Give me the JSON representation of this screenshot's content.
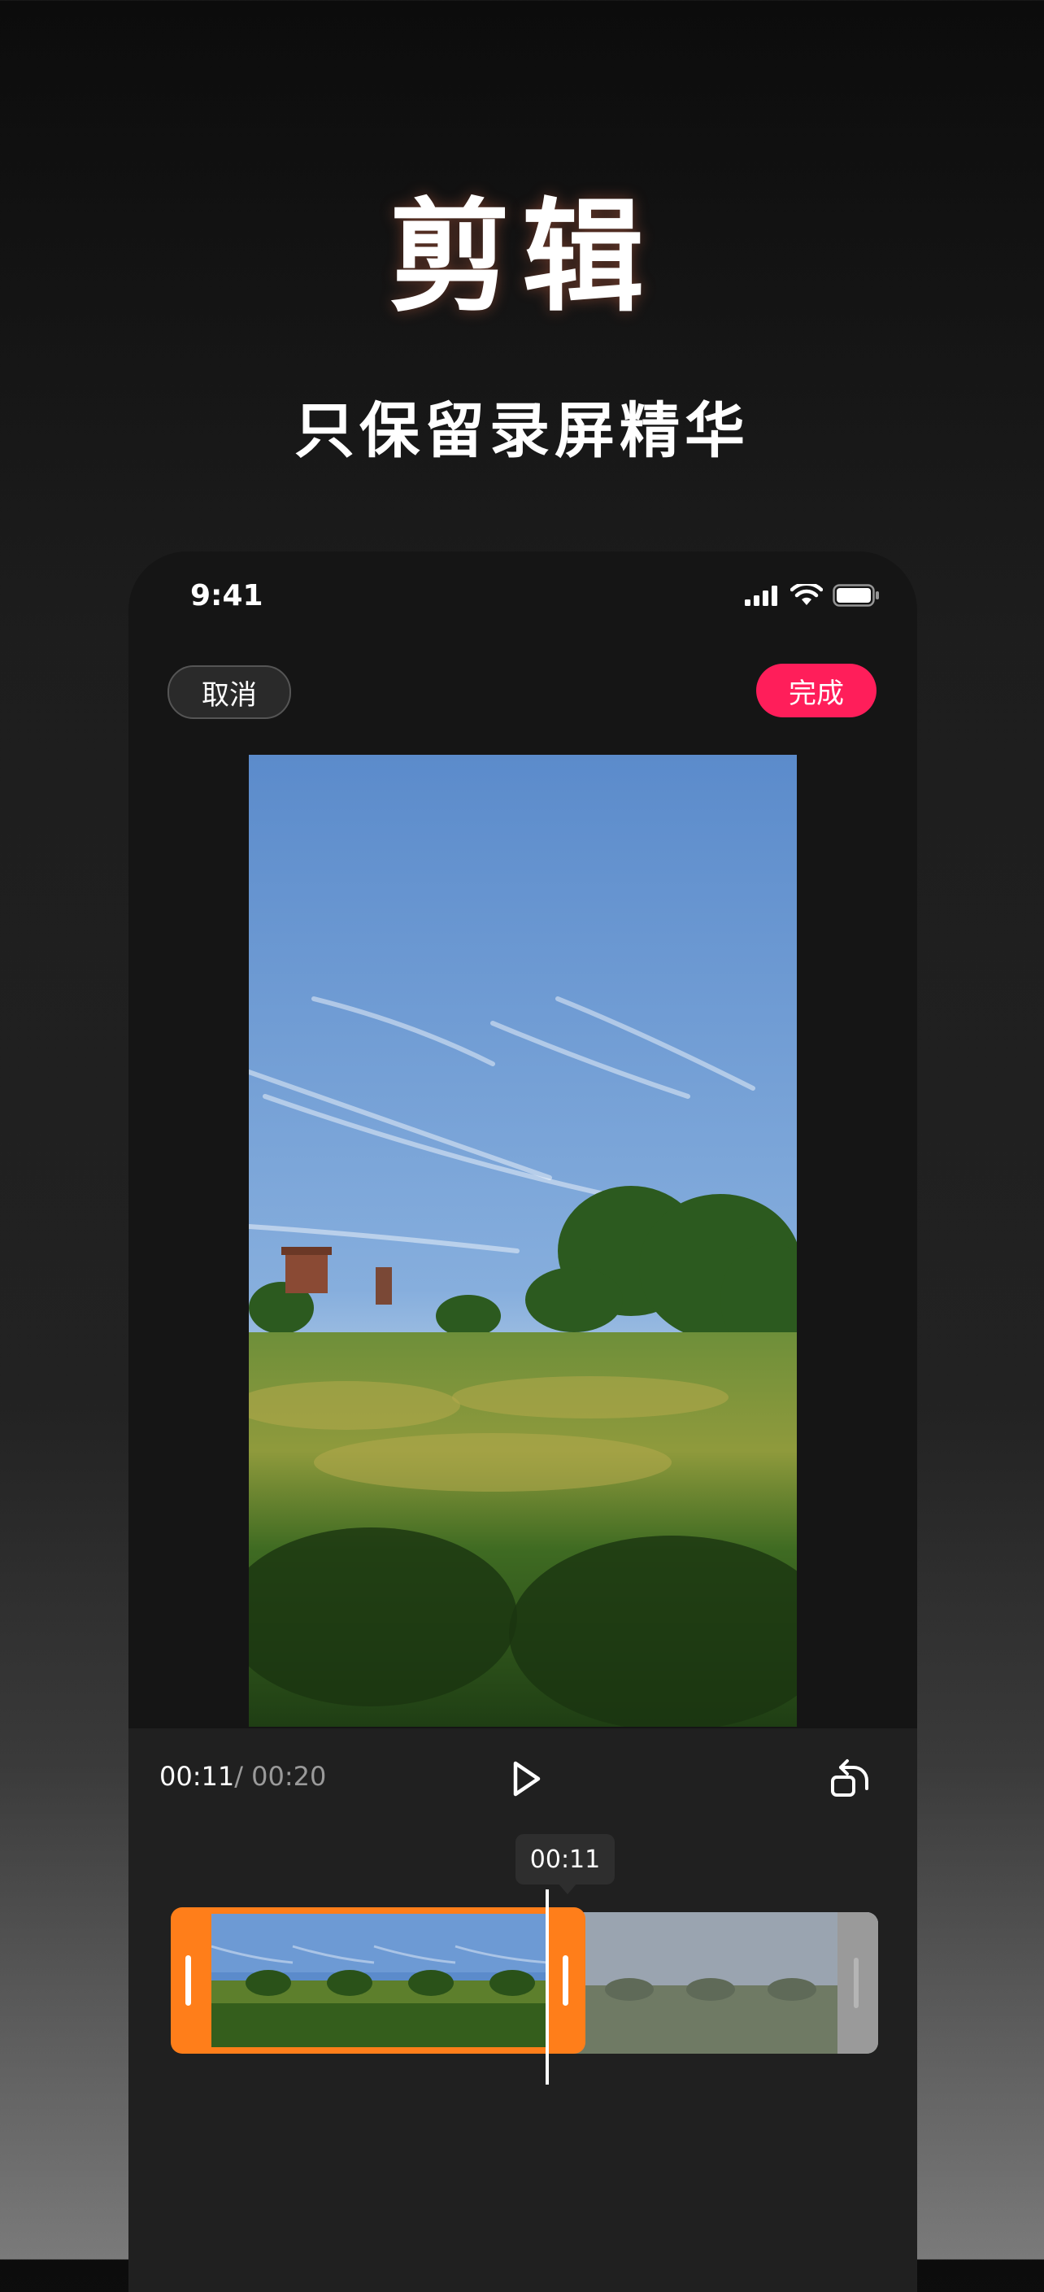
{
  "hero": {
    "title": "剪辑",
    "subtitle": "只保留录屏精华"
  },
  "status_bar": {
    "time": "9:41"
  },
  "editor": {
    "cancel_label": "取消",
    "done_label": "完成",
    "done_color": "#ff1e5a",
    "accent_color": "#ff7e1a",
    "current_time": "00:11",
    "total_time": "/ 00:20",
    "tooltip_time": "00:11",
    "selection_fraction": 0.55,
    "icons": [
      "signal-icon",
      "wifi-icon",
      "battery-icon",
      "play-icon",
      "undo-icon"
    ]
  }
}
